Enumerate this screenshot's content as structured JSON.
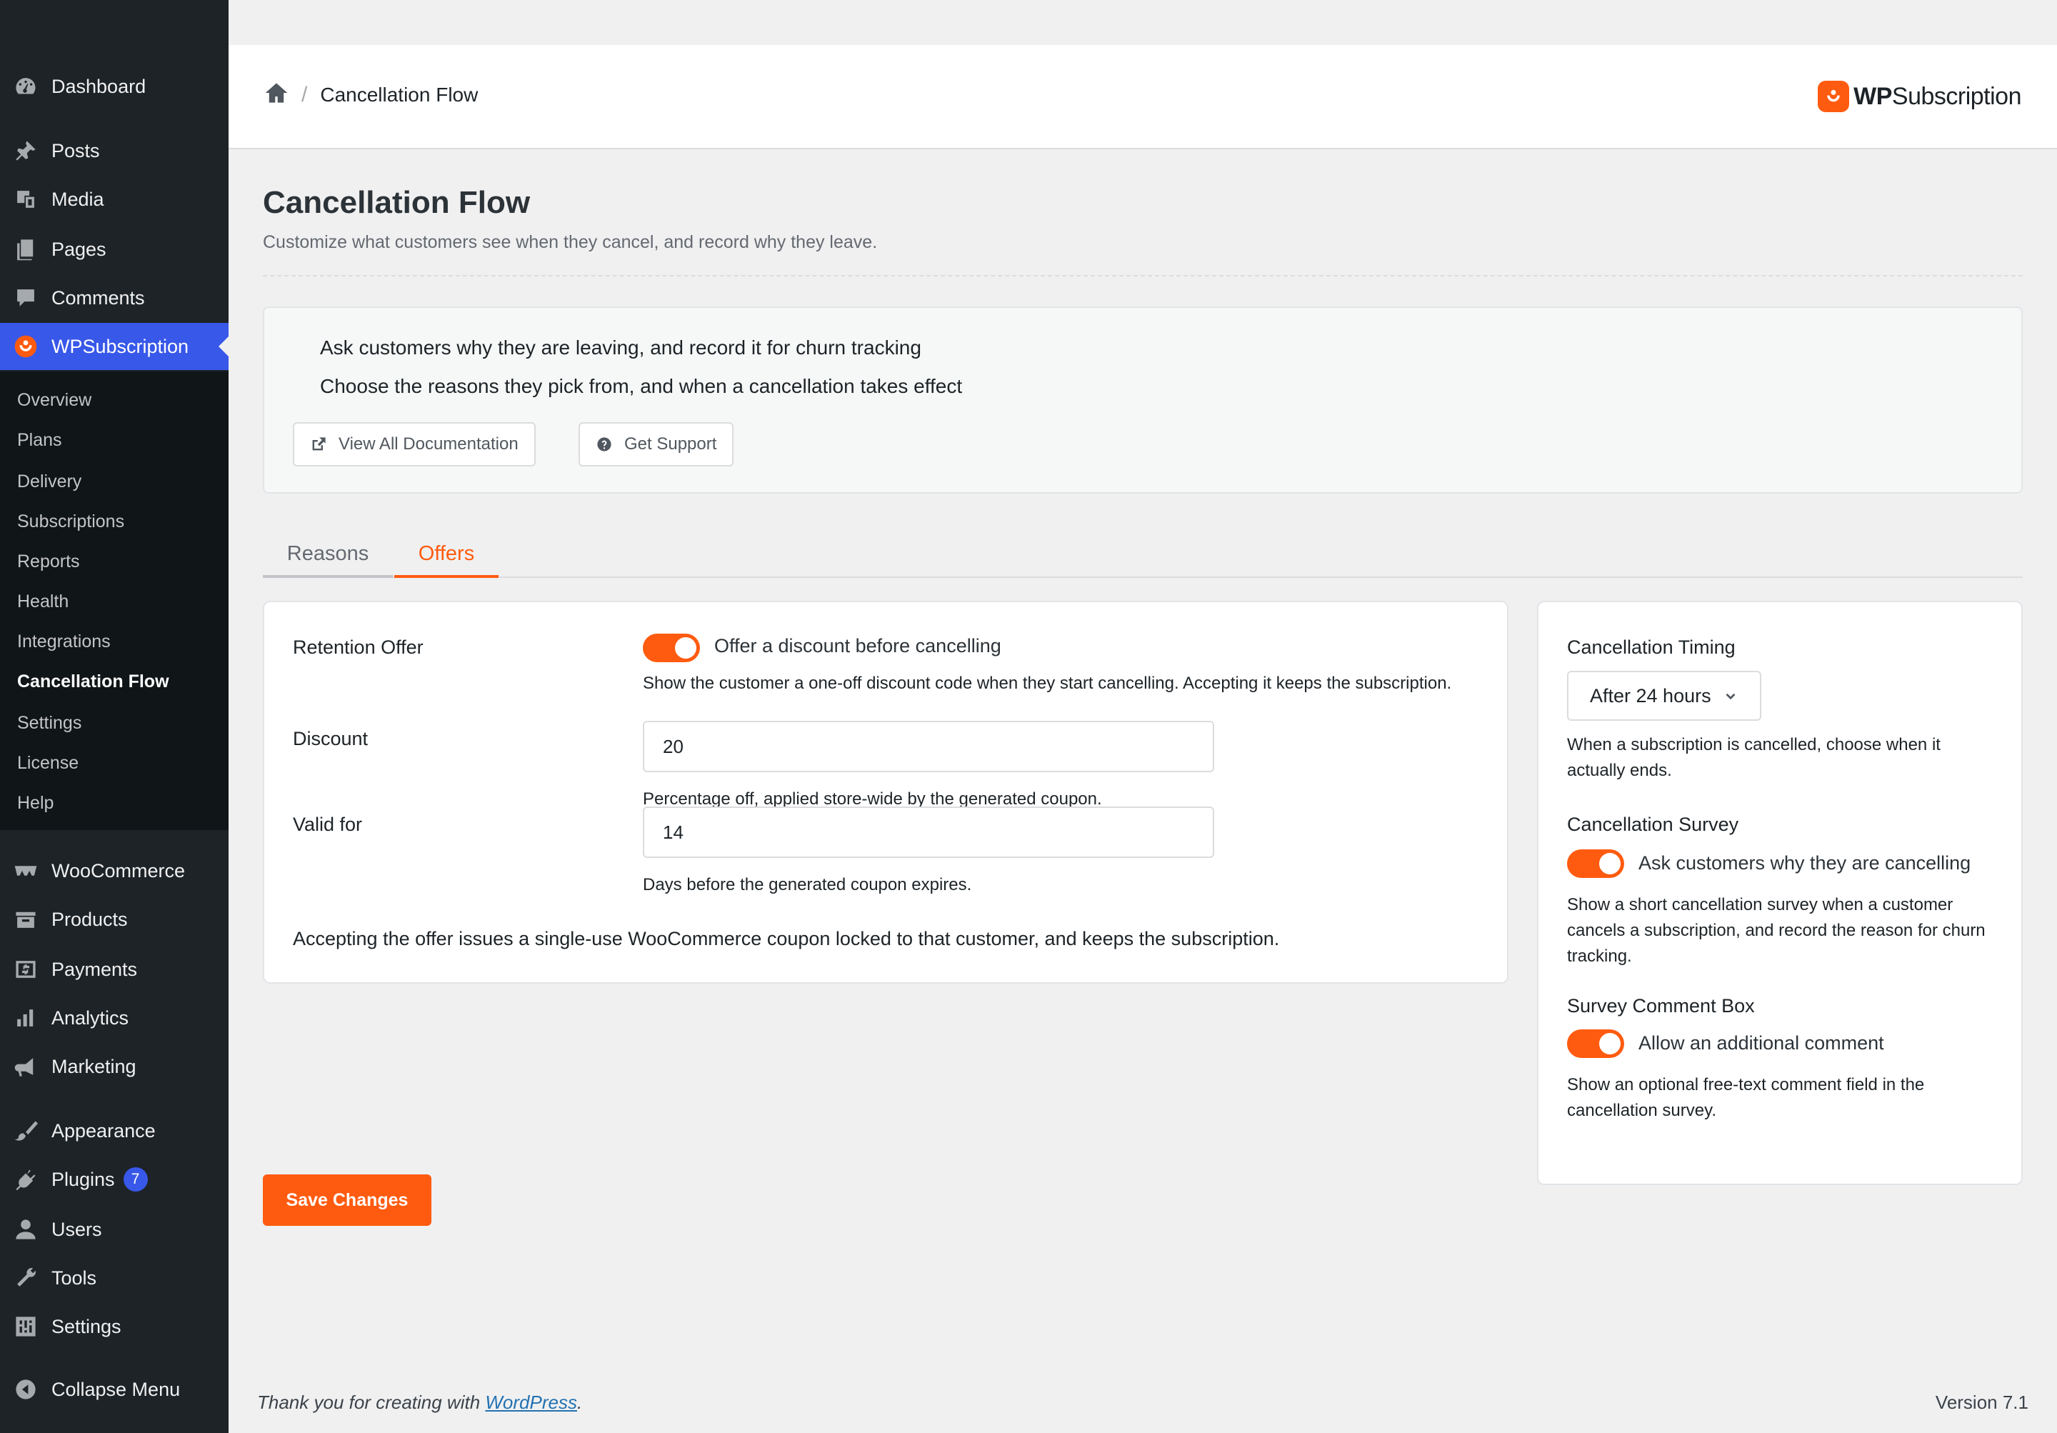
{
  "sidebar": {
    "menu": [
      {
        "label": "Dashboard",
        "icon": "dashboard-icon"
      },
      {
        "label": "Posts",
        "icon": "pin-icon"
      },
      {
        "label": "Media",
        "icon": "media-icon"
      },
      {
        "label": "Pages",
        "icon": "pages-icon"
      },
      {
        "label": "Comments",
        "icon": "comment-icon"
      },
      {
        "label": "WPSubscription",
        "icon": "wpsubscription-icon"
      },
      {
        "label": "WooCommerce",
        "icon": "woocommerce-icon"
      },
      {
        "label": "Products",
        "icon": "products-icon"
      },
      {
        "label": "Payments",
        "icon": "payments-icon"
      },
      {
        "label": "Analytics",
        "icon": "analytics-icon"
      },
      {
        "label": "Marketing",
        "icon": "megaphone-icon"
      },
      {
        "label": "Appearance",
        "icon": "brush-icon"
      },
      {
        "label": "Plugins",
        "icon": "plugin-icon",
        "badge": "7"
      },
      {
        "label": "Users",
        "icon": "user-icon"
      },
      {
        "label": "Tools",
        "icon": "wrench-icon"
      },
      {
        "label": "Settings",
        "icon": "settings-icon"
      },
      {
        "label": "Collapse Menu",
        "icon": "collapse-icon"
      }
    ],
    "submenu": [
      "Overview",
      "Plans",
      "Delivery",
      "Subscriptions",
      "Reports",
      "Health",
      "Integrations",
      "Cancellation Flow",
      "Settings",
      "License",
      "Help"
    ]
  },
  "header": {
    "breadcrumb": "Cancellation Flow",
    "brand_bold": "WP",
    "brand_rest": "Subscription"
  },
  "page": {
    "title": "Cancellation Flow",
    "subtitle": "Customize what customers see when they cancel, and record why they leave."
  },
  "info": {
    "line1": "Ask customers why they are leaving, and record it for churn tracking",
    "line2": "Choose the reasons they pick from, and when a cancellation takes effect",
    "docs_button": "View All Documentation",
    "support_button": "Get Support"
  },
  "tabs": [
    "Reasons",
    "Offers"
  ],
  "offers": {
    "retention_label": "Retention Offer",
    "retention_toggle_label": "Offer a discount before cancelling",
    "retention_help": "Show the customer a one-off discount code when they start cancelling. Accepting it keeps the subscription.",
    "discount_label": "Discount",
    "discount_value": "20",
    "discount_help": "Percentage off, applied store-wide by the generated coupon.",
    "valid_label": "Valid for",
    "valid_value": "14",
    "valid_help": "Days before the generated coupon expires.",
    "note": "Accepting the offer issues a single-use WooCommerce coupon locked to that customer, and keeps the subscription."
  },
  "side": {
    "timing_label": "Cancellation Timing",
    "timing_value": "After 24 hours",
    "timing_help": "When a subscription is cancelled, choose when it actually ends.",
    "survey_label": "Cancellation Survey",
    "survey_toggle_label": "Ask customers why they are cancelling",
    "survey_help": "Show a short cancellation survey when a customer cancels a subscription, and record the reason for churn tracking.",
    "comment_label": "Survey Comment Box",
    "comment_toggle_label": "Allow an additional comment",
    "comment_help": "Show an optional free-text comment field in the cancellation survey."
  },
  "save_label": "Save Changes",
  "footer": {
    "thanks_prefix": "Thank you for creating with ",
    "thanks_link": "WordPress",
    "thanks_suffix": ".",
    "version": "Version 7.1"
  },
  "colors": {
    "accent": "#ff5b10",
    "sidebar_bg": "#1d2327",
    "active_menu": "#3858e9"
  }
}
